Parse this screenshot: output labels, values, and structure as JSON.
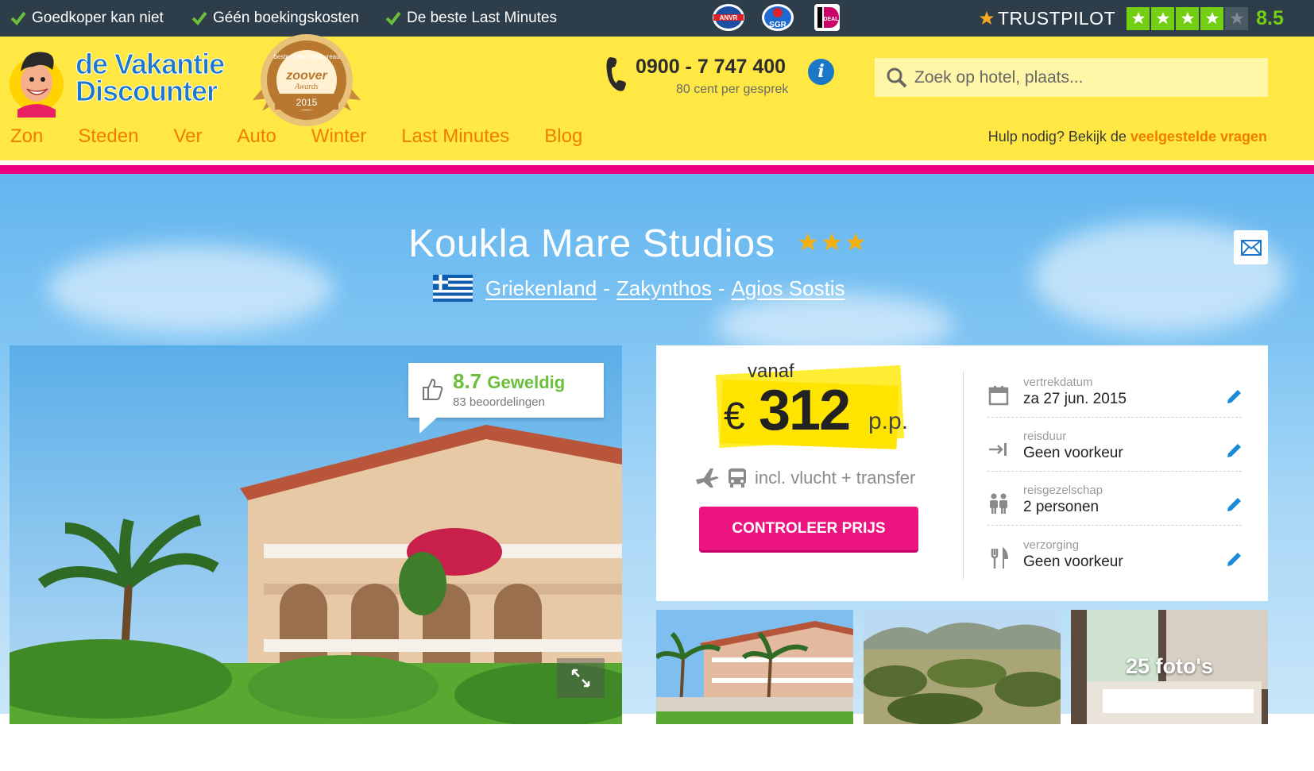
{
  "topbar": {
    "usps": [
      "Goedkoper kan niet",
      "Géén boekingskosten",
      "De beste Last Minutes"
    ],
    "badges": [
      "ANVR",
      "SGR",
      "iDEAL"
    ],
    "trustpilot": {
      "name": "TRUSTPILOT",
      "score": "8.5",
      "stars": 4.5
    }
  },
  "header": {
    "logo_line1": "de Vakantie",
    "logo_line2": "Discounter",
    "award": {
      "top": "beste online reisbureau",
      "brand": "zoover",
      "sub": "Awards",
      "year": "2015"
    },
    "phone": "0900 - 7 747 400",
    "phone_sub": "80 cent per gesprek",
    "info_icon": "i",
    "search_placeholder": "Zoek op hotel, plaats...",
    "nav": [
      "Zon",
      "Steden",
      "Ver",
      "Auto",
      "Winter",
      "Last Minutes",
      "Blog"
    ],
    "help_text": "Hulp nodig? Bekijk de ",
    "help_link": "veelgestelde vragen"
  },
  "hotel": {
    "name": "Koukla Mare Studios",
    "stars": 3,
    "breadcrumb": [
      "Griekenland",
      "Zakynthos",
      "Agios Sostis"
    ],
    "rating": {
      "score": "8.7",
      "label": "Geweldig",
      "count": "83 beoordelingen"
    }
  },
  "price": {
    "from_label": "vanaf",
    "currency": "€",
    "amount": "312",
    "per": "p.p.",
    "incl": "incl. vlucht + transfer",
    "cta": "CONTROLEER PRIJS"
  },
  "options": [
    {
      "label": "vertrekdatum",
      "value": "za 27 jun. 2015",
      "icon": "calendar-icon"
    },
    {
      "label": "reisduur",
      "value": "Geen voorkeur",
      "icon": "duration-icon"
    },
    {
      "label": "reisgezelschap",
      "value": "2 personen",
      "icon": "people-icon"
    },
    {
      "label": "verzorging",
      "value": "Geen voorkeur",
      "icon": "cutlery-icon"
    }
  ],
  "gallery": {
    "more_label": "25 foto's"
  },
  "colors": {
    "yellow": "#ffe843",
    "pink": "#ec1580",
    "orange": "#ef7d00",
    "blue": "#1b78c8",
    "green": "#6cbf3a",
    "dark": "#2d3e4a"
  }
}
